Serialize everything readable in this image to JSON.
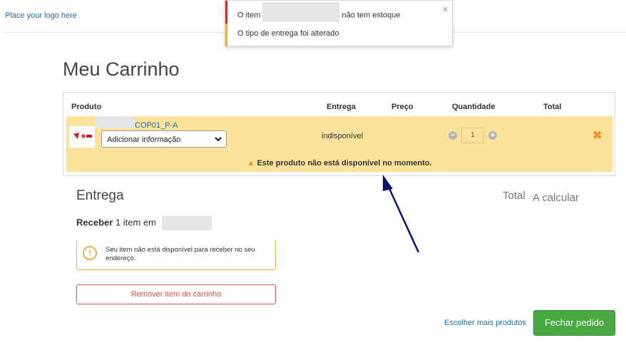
{
  "header": {
    "logo_text": "Place your logo here"
  },
  "toast": {
    "msg1_pre": "O item",
    "msg1_post": "não tem estoque",
    "msg2": "O tipo de entrega foi alterado",
    "close_glyph": "×",
    "colors": {
      "error": "#c9302c",
      "warning": "#f0ad4e"
    }
  },
  "page": {
    "title": "Meu Carrinho"
  },
  "cart": {
    "columns": {
      "produto": "Produto",
      "entrega": "Entrega",
      "preco": "Preço",
      "quantidade": "Quantidade",
      "total": "Total"
    },
    "item": {
      "name": "COP01_P-A",
      "select_value": "Adicionar informação",
      "entrega": "indisponível",
      "quantity": "1",
      "minus_glyph": "−",
      "plus_glyph": "+",
      "remove_glyph": "✖",
      "warning": "Este produto não está disponível no momento.",
      "row_color": "#fbe29b"
    }
  },
  "entrega": {
    "title": "Entrega",
    "total_label": "Total",
    "total_value": "A calcular",
    "receber_bold": "Receber",
    "receber_text": "1 item em",
    "notice_icon": "!",
    "notice": "Seu item não está disponível para receber no seu endereço.",
    "remove_button": "Remover item do carrinho"
  },
  "actions": {
    "more_products": "Escolher mais produtos",
    "checkout": "Fechar pedido",
    "checkout_color": "#4aa843"
  }
}
